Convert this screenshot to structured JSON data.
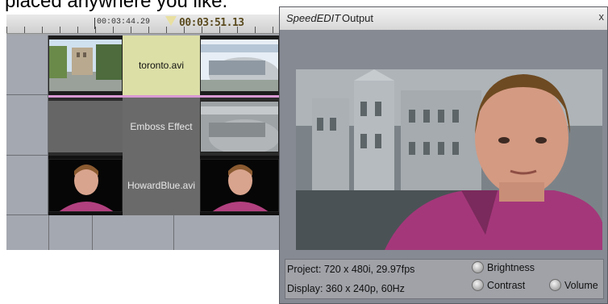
{
  "caption": {
    "text": "placed anywhere you like."
  },
  "timeline": {
    "timecode_marker": "00:03:44.29",
    "timecode_current": "00:03:51.13",
    "tracks": [
      {
        "clip_label": "toronto.avi"
      },
      {
        "clip_label": "Emboss Effect"
      },
      {
        "clip_label": "HowardBlue.avi"
      }
    ]
  },
  "output": {
    "title_italic": "SpeedEDIT",
    "title_rest": "Output",
    "close_glyph": "x",
    "project_info": "Project: 720 x 480i, 29.97fps",
    "display_info": "Display: 360 x 240p, 60Hz",
    "options": {
      "brightness": "Brightness",
      "contrast": "Contrast",
      "volume": "Volume"
    }
  },
  "colors": {
    "timeline_bg": "#a4a7ac",
    "clip_highlight": "#dcdfa6",
    "effect_marker": "#d99ad4",
    "window_bg": "#868a93"
  }
}
